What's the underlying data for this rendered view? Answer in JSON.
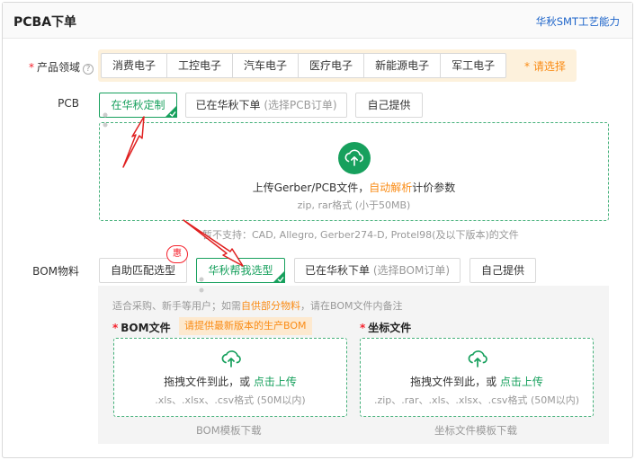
{
  "header": {
    "title": "PCBA下单",
    "link": "华秋SMT工艺能力"
  },
  "domain": {
    "label": "产品领域",
    "required": "*",
    "items": [
      "消费电子",
      "工控电子",
      "汽车电子",
      "医疗电子",
      "新能源电子",
      "军工电子"
    ],
    "hint": "* 请选择"
  },
  "pcb": {
    "label": "PCB",
    "options": {
      "custom": "在华秋定制",
      "ordered": "已在华秋下单",
      "ordered_sub": "(选择PCB订单)",
      "self": "自己提供"
    },
    "upload": {
      "prefix": "上传Gerber/PCB文件，",
      "link": "自动解析",
      "suffix": "计价参数",
      "sub": "zip, rar格式 (小于50MB)"
    },
    "unsupported": "暂不支持：CAD, Allegro, Gerber274-D, Protel98(及以下版本)的文件"
  },
  "bom": {
    "label": "BOM物料",
    "options": {
      "auto": "自助匹配选型",
      "help": "华秋帮我选型",
      "ordered": "已在华秋下单",
      "ordered_sub": "(选择BOM订单)",
      "self": "自己提供"
    },
    "badge": "惠",
    "note_prefix": "适合采购、新手等用户；如需",
    "note_link": "自供部分物料",
    "note_suffix": "，请在BOM文件内备注",
    "bom_file": {
      "required": "*",
      "title": "BOM文件",
      "tip": "请提供最新版本的生产BOM",
      "drag": "拖拽文件到此，或 ",
      "link": "点击上传",
      "formats": ".xls、.xlsx、.csv格式 (50M以内)",
      "template": "BOM模板下载"
    },
    "coord_file": {
      "required": "*",
      "title": "坐标文件",
      "drag": "拖拽文件到此，或 ",
      "link": "点击上传",
      "formats": ".zip、.rar、.xls、.xlsx、.csv格式 (50M以内)",
      "template": "坐标文件模板下载"
    }
  },
  "colors": {
    "accent": "#17a05d",
    "warning": "#fa8c16",
    "annotation": "#e02020",
    "link": "#1d64c9"
  }
}
